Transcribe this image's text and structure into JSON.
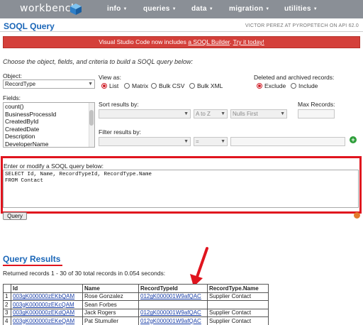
{
  "nav": {
    "brand": "workbench",
    "items": [
      "info",
      "queries",
      "data",
      "migration",
      "utilities"
    ]
  },
  "header": {
    "title": "SOQL Query",
    "user": "VICTOR PEREZ AT PYROPETECH ON API 62.0"
  },
  "banner": {
    "text": "Visual Studio Code now includes",
    "link1": "a SOQL Builder",
    "link2": "Try it today!"
  },
  "instructions": "Choose the object, fields, and criteria to build a SOQL query below:",
  "form": {
    "object_label": "Object:",
    "object_value": "RecordType",
    "fields_label": "Fields:",
    "fields": [
      "count()",
      "BusinessProcessId",
      "CreatedById",
      "CreatedDate",
      "Description",
      "DeveloperName"
    ],
    "view_label": "View as:",
    "view_options": [
      "List",
      "Matrix",
      "Bulk CSV",
      "Bulk XML"
    ],
    "deleted_label": "Deleted and archived records:",
    "deleted_options": [
      "Exclude",
      "Include"
    ],
    "sort_label": "Sort results by:",
    "sort_dir": "A to Z",
    "sort_nulls": "Nulls First",
    "max_label": "Max Records:",
    "filter_label": "Filter results by:",
    "filter_op": "="
  },
  "query": {
    "label": "Enter or modify a SOQL query below:",
    "text": "SELECT Id, Name, RecordTypeId, RecordType.Name\nFROM Contact",
    "button": "Query"
  },
  "results": {
    "title": "Query Results",
    "summary": "Returned records 1 - 30 of 30 total records in 0.054 seconds:",
    "headers": [
      "",
      "Id",
      "Name",
      "RecordTypeId",
      "RecordType.Name"
    ],
    "rows": [
      [
        "1",
        "003gK000000zEKbQAM",
        "Rose Gonzalez",
        "012gK000001W9afQAC",
        "Supplier Contact"
      ],
      [
        "2",
        "003gK000000zEKcQAM",
        "Sean Forbes",
        "",
        ""
      ],
      [
        "3",
        "003gK000000zEKdQAM",
        "Jack Rogers",
        "012gK000001W9afQAC",
        "Supplier Contact"
      ],
      [
        "4",
        "003gK000000zEKeQAM",
        "Pat Stumuller",
        "012gK000001W9afQAC",
        "Supplier Contact"
      ]
    ]
  }
}
